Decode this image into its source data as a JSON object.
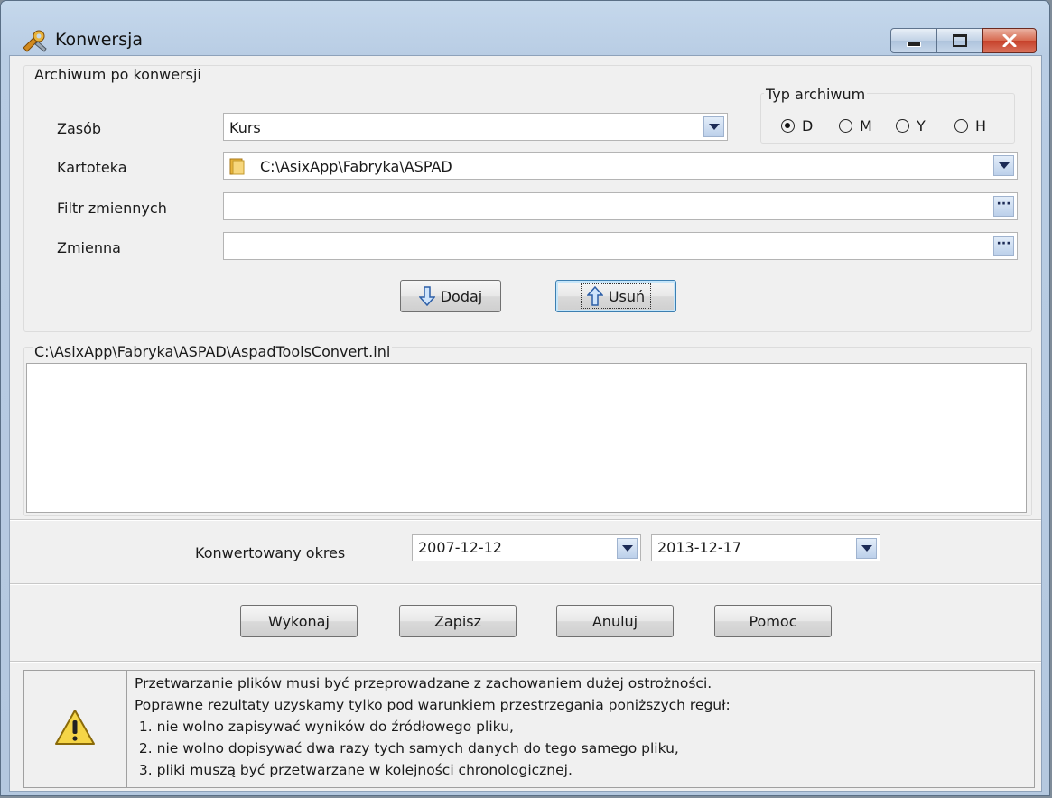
{
  "window": {
    "title": "Konwersja"
  },
  "archive_group": {
    "label": "Archiwum po konwersji",
    "zasob_label": "Zasób",
    "zasob_value": "Kurs",
    "kartoteka_label": "Kartoteka",
    "kartoteka_value": "C:\\AsixApp\\Fabryka\\ASPAD",
    "filtr_label": "Filtr zmiennych",
    "filtr_value": "",
    "zmienna_label": "Zmienna",
    "zmienna_value": "",
    "typ_label": "Typ archiwum",
    "typ_options": [
      "D",
      "M",
      "Y",
      "H"
    ],
    "typ_selected": "D",
    "add_label": "Dodaj",
    "remove_label": "Usuń"
  },
  "file_group": {
    "label": "C:\\AsixApp\\Fabryka\\ASPAD\\AspadToolsConvert.ini"
  },
  "period": {
    "label": "Konwertowany okres",
    "from": "2007-12-12",
    "to": "2013-12-17"
  },
  "actions": {
    "execute": "Wykonaj",
    "save": "Zapisz",
    "cancel": "Anuluj",
    "help": "Pomoc"
  },
  "warning": {
    "lines": [
      "Przetwarzanie plików musi być przeprowadzane z zachowaniem dużej ostrożności.",
      "Poprawne rezultaty uzyskamy tylko pod warunkiem przestrzegania poniższych reguł:",
      " 1. nie wolno zapisywać wyników do źródłowego pliku,",
      " 2. nie wolno dopisywać dwa razy tych samych danych do tego samego pliku,",
      " 3. pliki muszą być przetwarzane w kolejności chronologicznej."
    ]
  },
  "colors": {
    "accent": "#3c7fb1",
    "titlebar": "#b9cde4",
    "close": "#c6402a",
    "warning": "#f5d547"
  }
}
